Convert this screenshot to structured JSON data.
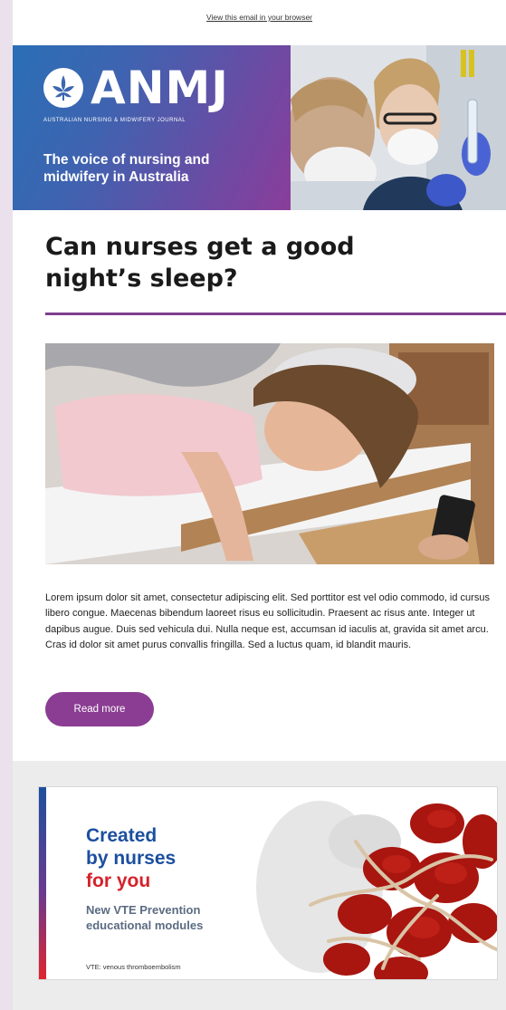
{
  "email": {
    "view_in_browser": "View this email in your browser"
  },
  "header": {
    "logo_text": "ANMJ",
    "journal_name": "AUSTRALIAN NURSING & MIDWIFERY JOURNAL",
    "tagline": "The voice of nursing and midwifery in Australia"
  },
  "article": {
    "title": "Can nurses get a good night’s sleep?",
    "body": "Lorem ipsum dolor sit amet, consectetur adipiscing elit. Sed porttitor est vel odio commodo, id cursus libero congue. Maecenas bibendum laoreet risus eu sollicitudin. Praesent ac risus ante. Integer ut dapibus augue. Duis sed vehicula dui. Nulla neque est, accumsan id iaculis at, gravida sit amet arcu. Cras id dolor sit amet purus convallis fringilla. Sed a luctus quam, id blandit mauris.",
    "read_more_label": "Read more"
  },
  "ad": {
    "line1": "Created",
    "line2": "by nurses",
    "line3": "for you",
    "subtitle": "New VTE Prevention educational modules",
    "footnote": "VTE: venous thromboembolism"
  },
  "colors": {
    "accent_purple": "#8a3d92",
    "rule_purple": "#7e3f8f",
    "ad_blue": "#1b4f9f",
    "ad_red": "#d6222b"
  }
}
